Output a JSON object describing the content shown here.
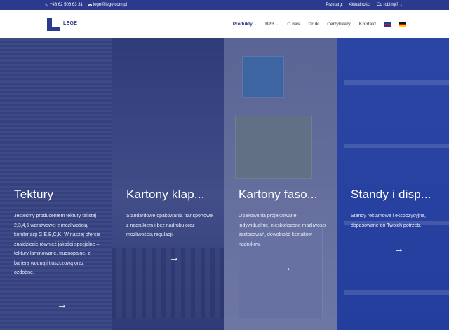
{
  "topbar": {
    "phone": "+48 62 506 63 31",
    "email": "lege@lege.com.pl",
    "links": [
      "Przetargi",
      "Aktualności",
      "Co robimy?"
    ]
  },
  "header": {
    "logo_text": "LEGE",
    "nav": [
      {
        "label": "Produkty",
        "has_dropdown": true,
        "active": true
      },
      {
        "label": "B2B",
        "has_dropdown": true,
        "active": false
      },
      {
        "label": "O nas",
        "has_dropdown": false,
        "active": false
      },
      {
        "label": "Druk",
        "has_dropdown": false,
        "active": false
      },
      {
        "label": "Certyfikaty",
        "has_dropdown": false,
        "active": false
      },
      {
        "label": "Kontakt",
        "has_dropdown": false,
        "active": false
      }
    ]
  },
  "panels": [
    {
      "title": "Tektury",
      "text": "Jesteśmy producentem tektury falistej 2,3,4,5 warstwowej z możliwością kombinacji G,E,B,C,K. W naszej ofercie znajdziecie również jakości specjalne – tektury laminowane, trudnopalne, z barierą wodną i tłuszczową oraz ozdobne."
    },
    {
      "title": "Kartony klap...",
      "text": "Standardowe opakowania transportowe z nadrukiem i bez nadruku oraz możliwością regulacji."
    },
    {
      "title": "Kartony faso...",
      "text": "Opakowania projektowane indywidualnie, nieskończone możliwości zastosowań, dowolność kształtów i nadruków."
    },
    {
      "title": "Standy i disp...",
      "text": "Standy reklamowe i ekspozycyjne, dopasowane do Twoich potrzeb."
    }
  ],
  "colors": {
    "brand": "#2b3a8c",
    "overlay": "#263482"
  }
}
